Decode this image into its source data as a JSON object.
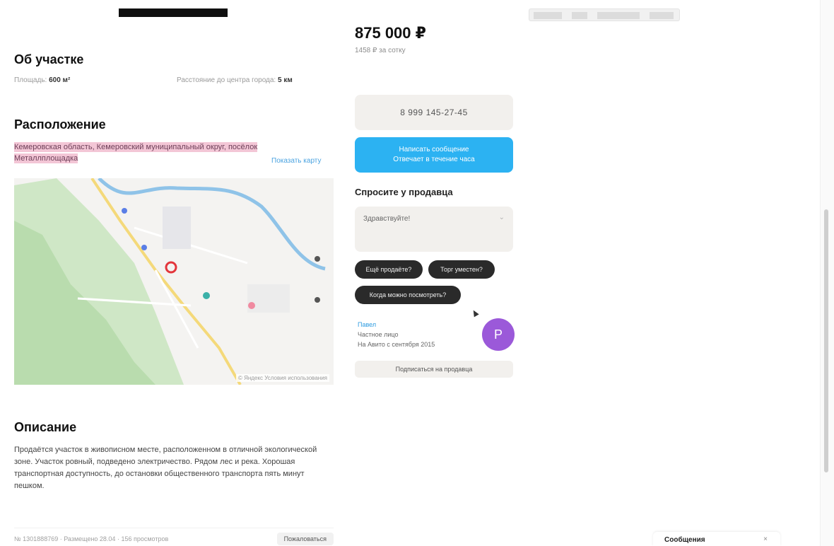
{
  "listing": {
    "price": "875 000 ₽",
    "price_per_unit": "1458 ₽ за сотку"
  },
  "about": {
    "title": "Об участке",
    "area_label": "Площадь:",
    "area_value": "600 м²",
    "distance_label": "Расстояние до центра города:",
    "distance_value": "5 км"
  },
  "location": {
    "title": "Расположение",
    "address": "Кемеровская область, Кемеровский муниципальный округ, посёлок Металлплощадка",
    "show_on_map": "Показать карту"
  },
  "map": {
    "attribution": "© Яндекс  Условия использования"
  },
  "description": {
    "title": "Описание",
    "text": "Продаётся участок в живописном месте, расположенном в отличной экологической зоне. Участок ровный, подведено электричество. Рядом лес и река. Хорошая транспортная доступность, до остановки общественного транспорта пять минут пешком.",
    "meta": "№ 1301888769 · Размещено 28.04 · 156 просмотров",
    "report_label": "Пожаловаться"
  },
  "contacts": {
    "phone": "8 999 145-27-45",
    "write_line1": "Написать сообщение",
    "write_line2": "Отвечает в течение часа"
  },
  "ask_seller": {
    "title": "Спросите у продавца",
    "placeholder": "Здравствуйте!",
    "chips": [
      "Ещё продаёте?",
      "Торг уместен?",
      "Когда можно посмотреть?"
    ]
  },
  "seller": {
    "name": "Павел",
    "type": "Частное лицо",
    "since": "На Авито с сентября 2015",
    "avatar_letter": "P",
    "more_button": "Подписаться на продавца",
    "avatar_color": "#9b59d9"
  },
  "messenger": {
    "label": "Сообщения",
    "close": "×"
  }
}
